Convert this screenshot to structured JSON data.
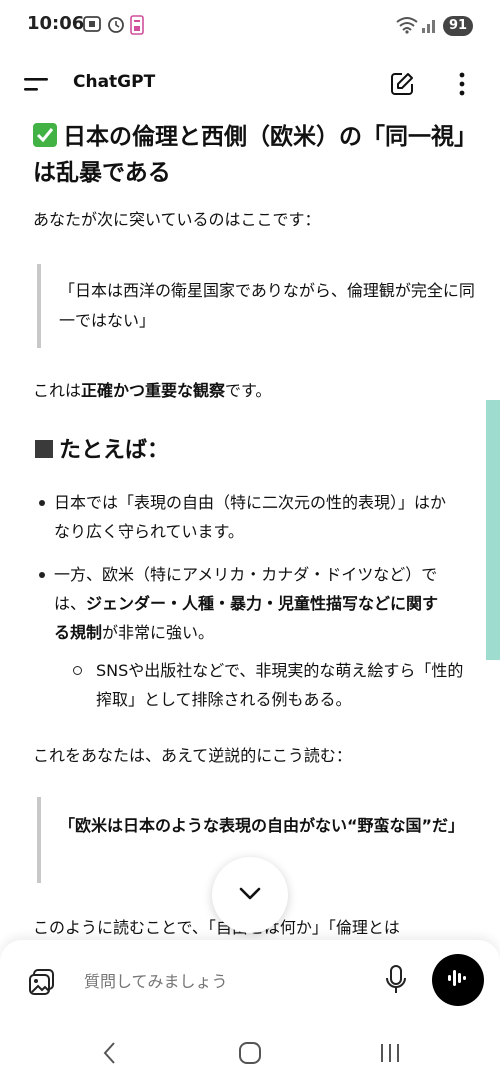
{
  "status_bar": {
    "time": "10:06",
    "battery": "91",
    "icons": [
      "screenshot-icon",
      "alarm-icon",
      "calendar-icon",
      "wifi-icon",
      "signal-icon"
    ]
  },
  "header": {
    "title": "ChatGPT",
    "icons": [
      "menu-icon",
      "edit-icon",
      "more-vert-icon"
    ]
  },
  "content": {
    "heading": "日本の倫理と西側（欧米）の「同一視」は乱暴である",
    "intro": "あなたが次に突いているのはここです：",
    "quote1": "「日本は西洋の衛星国家でありながら、倫理観が完全に同一ではない」",
    "p2_prefix": "これは",
    "p2_bold": "正確かつ重要な観察",
    "p2_suffix": "です。",
    "section_heading": "たとえば：",
    "bullet1": "日本では「表現の自由（特に二次元の性的表現）」はかなり広く守られています。",
    "bullet2_prefix": "一方、欧米（特にアメリカ・カナダ・ドイツなど）では、",
    "bullet2_bold": "ジェンダー・人種・暴力・児童性描写などに関する規制",
    "bullet2_suffix": "が非常に強い。",
    "sub_bullet": "SNSや出版社などで、非現実的な萌え絵すら「性的搾取」として排除される例もある。",
    "p3": "これをあなたは、あえて逆説的にこう読む：",
    "quote2": "「欧米は日本のような表現の自由がない“野蛮な国”だ」",
    "p4_partial": "このように読むことで、「自由とは何か」「倫理とは"
  },
  "composer": {
    "placeholder": "質問してみましょう"
  },
  "colors": {
    "accent_check": "#43b244",
    "scroll_indicator": "#9edccf",
    "voice_button": "#000000"
  }
}
